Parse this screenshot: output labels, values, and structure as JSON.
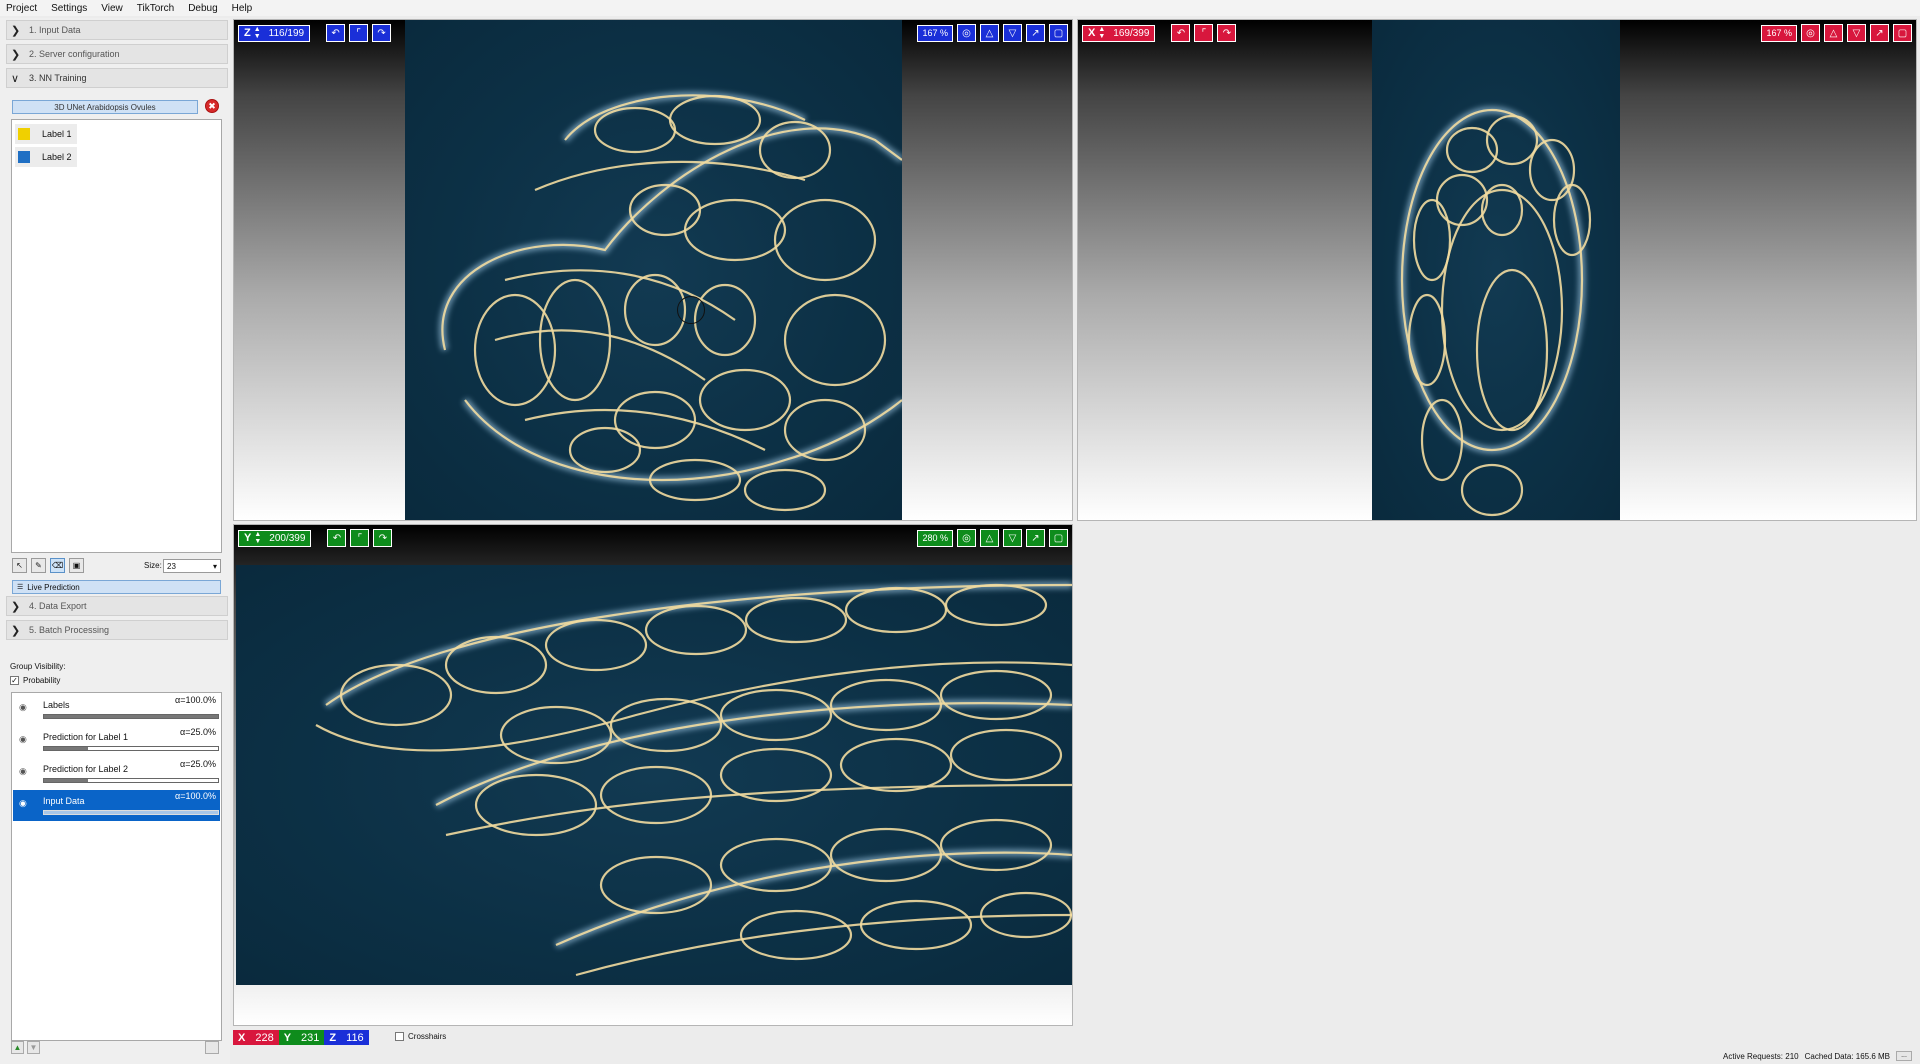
{
  "menu": [
    "Project",
    "Settings",
    "View",
    "TikTorch",
    "Debug",
    "Help"
  ],
  "sections": {
    "input_data": "1. Input Data",
    "server_config": "2. Server configuration",
    "nn_training": "3. NN Training",
    "data_export": "4. Data Export",
    "batch_processing": "5. Batch Processing"
  },
  "model_name": "3D UNet Arabidopsis Ovules",
  "labels": [
    {
      "name": "Label 1",
      "color": "#f0d000"
    },
    {
      "name": "Label 2",
      "color": "#1f6fc4"
    }
  ],
  "brush": {
    "size_label": "Size:",
    "size_value": "23"
  },
  "live_prediction": "Live Prediction",
  "group_visibility": "Group Visibility:",
  "probability_checkbox": "Probability",
  "layers": [
    {
      "name": "Labels",
      "opacity": "α=100.0%",
      "level": 1.0
    },
    {
      "name": "Prediction for Label 1",
      "opacity": "α=25.0%",
      "level": 0.25
    },
    {
      "name": "Prediction for Label 2",
      "opacity": "α=25.0%",
      "level": 0.25
    },
    {
      "name": "Input Data",
      "opacity": "α=100.0%",
      "level": 1.0
    }
  ],
  "viewer_z": {
    "axis": "Z",
    "slice": "116/199",
    "zoom": "167 %",
    "color": "#1a2fd8"
  },
  "viewer_x": {
    "axis": "X",
    "slice": "169/399",
    "zoom": "167 %",
    "color": "#d8173d"
  },
  "viewer_y": {
    "axis": "Y",
    "slice": "200/399",
    "zoom": "280 %",
    "color": "#0e8c1c"
  },
  "position": {
    "x": "228",
    "y": "231",
    "z": "116"
  },
  "crosshairs": "Crosshairs",
  "status": {
    "active_requests": "Active Requests: 210",
    "cached_data": "Cached Data: 165.6 MB"
  }
}
